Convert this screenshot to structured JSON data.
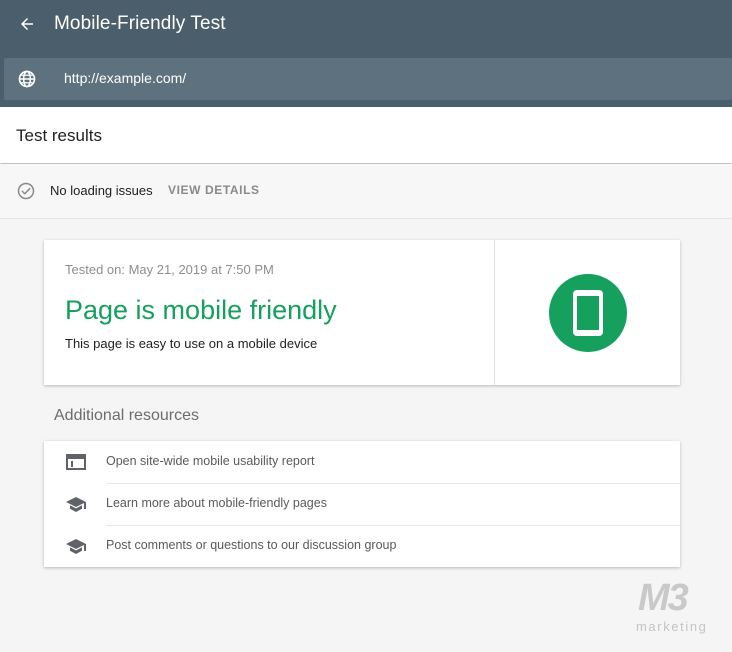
{
  "appbar": {
    "title": "Mobile-Friendly Test",
    "back_icon": "arrow-back-icon",
    "url_icon": "globe-icon",
    "url_value": "http://example.com/"
  },
  "results": {
    "title": "Test results",
    "status_icon": "check-circle-icon",
    "status_text": "No loading issues",
    "view_details": "VIEW DETAILS"
  },
  "card": {
    "tested_on": "Tested on: May 21, 2019 at 7:50 PM",
    "headline": "Page is mobile friendly",
    "subline": "This page is easy to use on a mobile device",
    "badge_icon": "mobile-phone-icon"
  },
  "additional": {
    "title": "Additional resources",
    "items": [
      {
        "label": "Open site-wide mobile usability report",
        "icon": "browser-window-icon"
      },
      {
        "label": "Learn more about mobile-friendly pages",
        "icon": "graduation-cap-icon"
      },
      {
        "label": "Post comments or questions to our discussion group",
        "icon": "graduation-cap-icon"
      }
    ]
  },
  "watermark": {
    "logo": "M3",
    "sub": "marketing"
  },
  "colors": {
    "appbar": "#4a5e6b",
    "urlbar": "#5e717e",
    "success": "#16a05d",
    "background": "#f5f5f5"
  }
}
